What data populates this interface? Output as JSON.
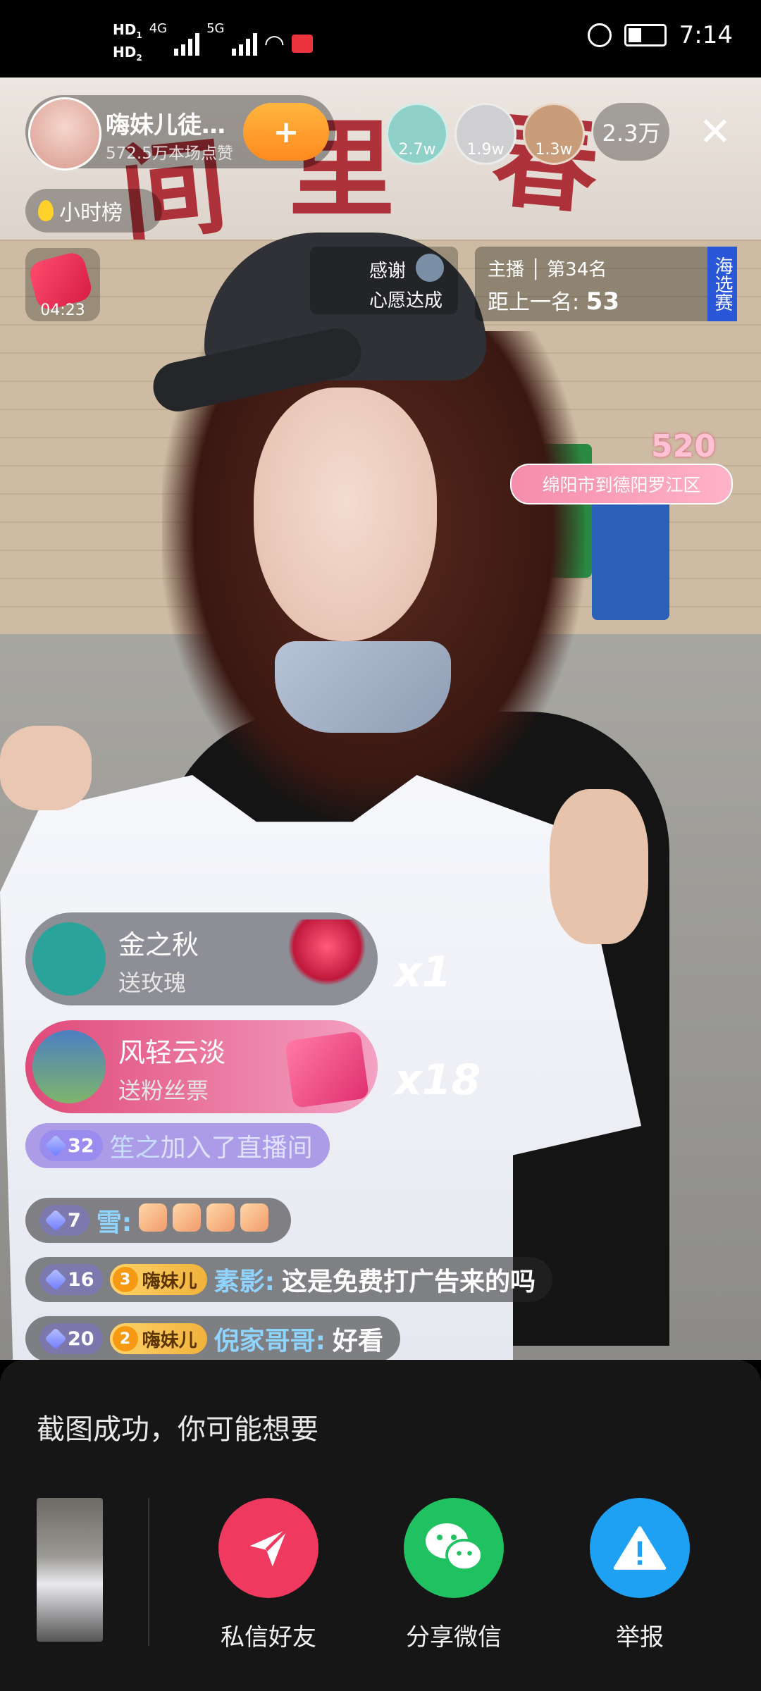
{
  "status_bar": {
    "hd1": "HD",
    "hd1_sub": "1",
    "hd2": "HD",
    "hd2_sub": "2",
    "net1": "4G",
    "net2": "5G",
    "time": "7:14"
  },
  "live": {
    "anchor_name": "嗨妹儿徒...",
    "anchor_likes": "572.5万本场点赞",
    "follow_symbol": "+",
    "viewers": [
      {
        "badge": "2.7w",
        "color": "#8fd0c9"
      },
      {
        "badge": "1.9w",
        "color": "#cfcfd2"
      },
      {
        "badge": "1.3w",
        "color": "#c99d7a"
      }
    ],
    "viewer_count": "2.3万",
    "close_symbol": "✕",
    "hour_rank": "小时榜",
    "timer": "04:23",
    "thanks_line1": "感谢",
    "thanks_line2": "心愿达成",
    "rank_line1": "主播 │ 第34名",
    "rank_line2_label": "距上一名: ",
    "rank_line2_value": "53",
    "rank_side": "海选赛",
    "location_num": "520",
    "location": "绵阳市到德阳罗江区"
  },
  "gifts": [
    {
      "name": "金之秋",
      "action": "送玫瑰",
      "count": "x1",
      "bg": "rgba(60,60,70,.55)",
      "avatar": "#2aa39b",
      "icon": "#e8305a"
    },
    {
      "name": "风轻云淡",
      "action": "送粉丝票",
      "count": "x18",
      "bg": "linear-gradient(90deg,#e04a7a,#f3a2c2)",
      "avatar": "#4c7fc2",
      "icon": "#ff5b8d"
    }
  ],
  "join": {
    "level": "32",
    "user": "笙之",
    "text": " 加入了直播间"
  },
  "comments": [
    {
      "level": "7",
      "user": "雪:",
      "text": ""
    },
    {
      "level": "16",
      "fan_level": "3",
      "fan_name": "嗨妹儿",
      "user": "素影:",
      "text": "这是免费打广告来的吗"
    },
    {
      "level": "20",
      "fan_level": "2",
      "fan_name": "嗨妹儿",
      "user": "倪家哥哥:",
      "text": "好看"
    }
  ],
  "sheet": {
    "title": "截图成功，你可能想要",
    "actions": [
      {
        "label": "私信好友",
        "color": "#f0395f",
        "icon": "paper-plane-icon"
      },
      {
        "label": "分享微信",
        "color": "#1fc160",
        "icon": "wechat-icon"
      },
      {
        "label": "举报",
        "color": "#1ea0f3",
        "icon": "warning-icon"
      }
    ]
  }
}
